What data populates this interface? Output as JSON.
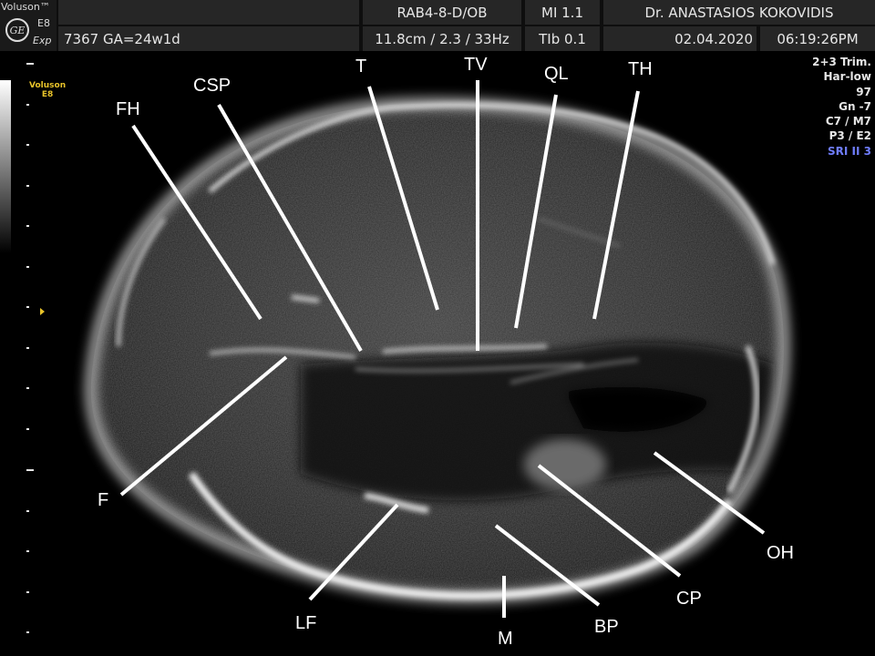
{
  "header": {
    "brand": "Voluson™",
    "logo_text": "GE",
    "model": "E8",
    "mode": "Exp",
    "patient_line": "7367  GA=24w1d",
    "probe": "RAB4-8-D/OB",
    "depth_info": "11.8cm / 2.3 / 33Hz",
    "mi": "MI  1.1",
    "tib": "TIb  0.1",
    "doctor": "Dr. ANASTASIOS KOKOVIDIS",
    "date": "02.04.2020",
    "time": "06:19:26PM"
  },
  "side": {
    "logo_line1": "Voluson",
    "logo_line2": "E8"
  },
  "params": [
    "2+3 Trim.",
    "Har-low",
    "97",
    "Gn  -7",
    "C7 / M7",
    "P3 / E2",
    "SRI II 3"
  ],
  "labels": {
    "t": "T",
    "tv": "TV",
    "ql": "QL",
    "th": "TH",
    "csp": "CSP",
    "fh": "FH",
    "f": "F",
    "lf": "LF",
    "m": "M",
    "bp": "BP",
    "cp": "CP",
    "oh": "OH"
  }
}
